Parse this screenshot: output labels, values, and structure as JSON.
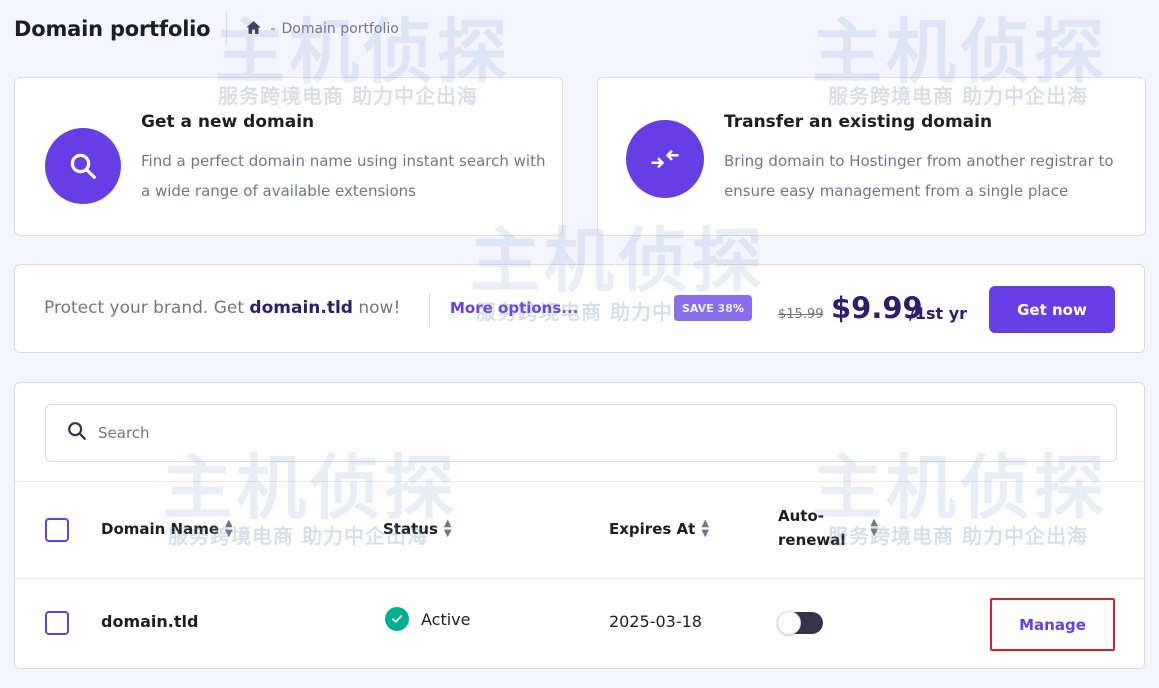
{
  "header": {
    "title": "Domain portfolio",
    "breadcrumb_sep": "-",
    "breadcrumb_current": "Domain portfolio"
  },
  "offers": [
    {
      "title": "Get a new domain",
      "description": "Find a perfect domain name using instant search with a wide range of available extensions",
      "icon": "search-icon"
    },
    {
      "title": "Transfer an existing domain",
      "description": "Bring domain to Hostinger from another registrar to ensure easy management from a single place",
      "icon": "transfer-arrows-icon"
    }
  ],
  "promo": {
    "text_before": "Protect your brand. Get ",
    "domain": "domain.tld",
    "text_after": " now!",
    "more_options": "More options...",
    "badge": "SAVE 38%",
    "old_price": "$15.99",
    "new_price": "$9.99",
    "price_unit": "/1st yr",
    "cta": "Get now"
  },
  "search": {
    "placeholder": "Search"
  },
  "table": {
    "columns": {
      "domain": "Domain Name",
      "status": "Status",
      "expires": "Expires At",
      "auto_renewal": "Auto-renewal"
    },
    "rows": [
      {
        "domain": "domain.tld",
        "status": "Active",
        "expires": "2025-03-18",
        "auto_renewal": false,
        "action": "Manage"
      }
    ]
  },
  "watermark": {
    "big": "主机侦探",
    "small": "服务跨境电商 助力中企出海"
  },
  "colors": {
    "primary": "#673de6",
    "active": "#00b090",
    "highlight": "#d6202e"
  }
}
